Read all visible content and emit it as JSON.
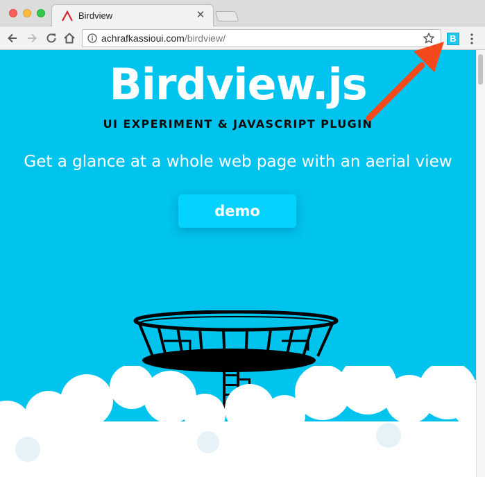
{
  "browser": {
    "tab_title": "Birdview",
    "url_host": "achrafkassioui.com",
    "url_path": "/birdview/",
    "extension_letter": "B"
  },
  "page": {
    "title": "Birdview.js",
    "subtitle": "UI EXPERIMENT & JAVASCRIPT PLUGIN",
    "tagline": "Get a glance at a whole web page with an aerial view",
    "demo_label": "demo"
  },
  "colors": {
    "page_background": "#00c3ee",
    "demo_button": "#05d3ff",
    "annotation_arrow": "#f5491b",
    "extension_icon": "#1ec8ec"
  },
  "icons": {
    "back": "arrow-left-icon",
    "forward": "arrow-right-icon",
    "reload": "reload-icon",
    "home": "home-icon",
    "info": "info-icon",
    "bookmark": "star-icon",
    "menu": "vertical-dots-icon"
  }
}
